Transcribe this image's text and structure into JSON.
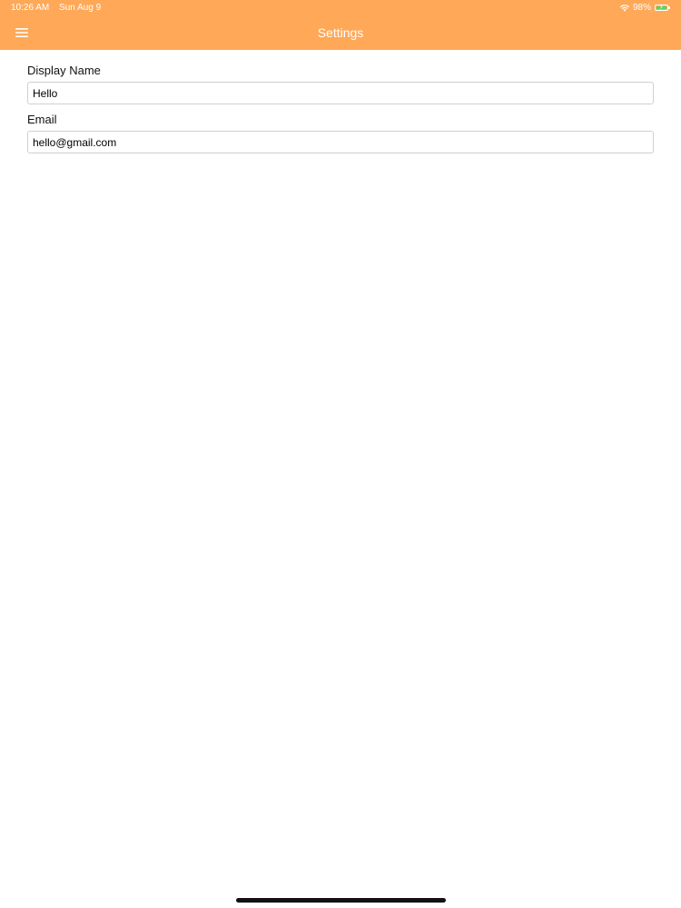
{
  "status_bar": {
    "time": "10:26 AM",
    "date": "Sun Aug 9",
    "battery": "98%",
    "battery_level": 0.98
  },
  "nav": {
    "title": "Settings",
    "menu_icon": "hamburger-menu-icon"
  },
  "form": {
    "display_name": {
      "label": "Display Name",
      "value": "Hello"
    },
    "email": {
      "label": "Email",
      "value": "hello@gmail.com"
    }
  },
  "colors": {
    "header": "#FFA857",
    "battery_fill": "#4CD964",
    "header_text": "#FFFFFF"
  }
}
